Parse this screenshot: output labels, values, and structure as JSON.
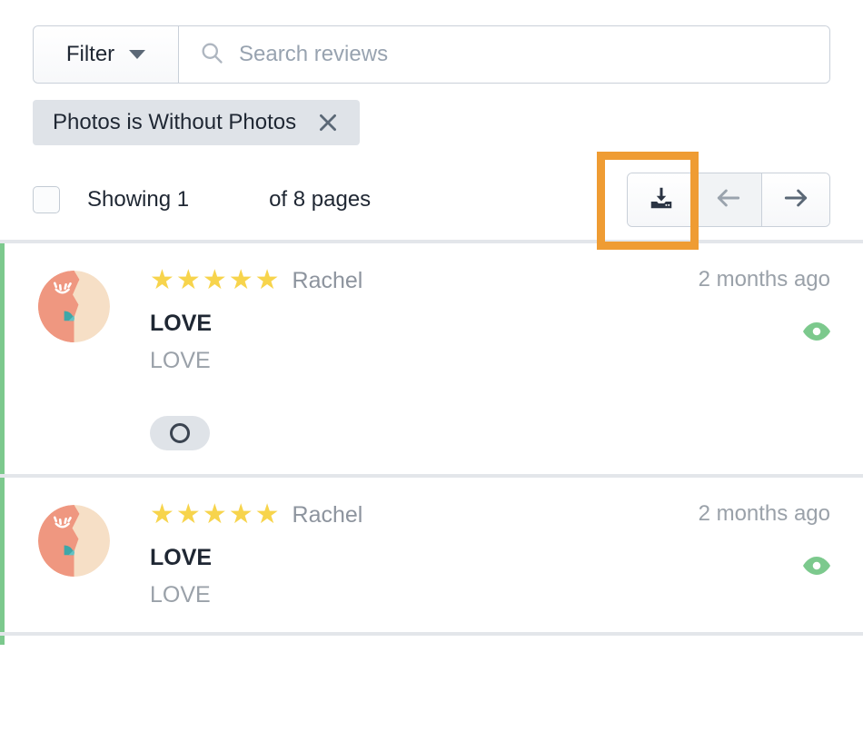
{
  "toolbar": {
    "filter_label": "Filter",
    "filter_caret_icon": "chevron-down-icon",
    "search_icon": "search-icon",
    "search_value": "",
    "search_placeholder": "Search reviews"
  },
  "filter_chip": {
    "label": "Photos is Without Photos",
    "remove_icon": "close-icon"
  },
  "pagination": {
    "select_all_checked": false,
    "showing_text": "Showing 1",
    "of_pages_text": "of 8 pages",
    "current_page": 1,
    "total_pages": 8,
    "download_icon": "download-icon",
    "prev_icon": "arrow-left-icon",
    "next_icon": "arrow-right-icon",
    "prev_enabled": false,
    "next_enabled": true
  },
  "highlight": {
    "target": "download-button",
    "color": "#ef9c33"
  },
  "colors": {
    "accent_green": "#7cc98d",
    "star_yellow": "#f7d44c",
    "chip_bg": "#dfe3e8",
    "eye_green": "#7cc98d",
    "highlight_orange": "#ef9c33"
  },
  "reviews": [
    {
      "avatar_icon": "avatar-face-icon",
      "rating": 5,
      "stars": [
        "★",
        "★",
        "★",
        "★",
        "★"
      ],
      "reviewer": "Rachel",
      "title": "LOVE",
      "body": "LOVE",
      "timestamp": "2 months ago",
      "visibility_icon": "eye-icon",
      "badge_icon": "circle-ring-icon",
      "has_badge": true
    },
    {
      "avatar_icon": "avatar-face-icon",
      "rating": 5,
      "stars": [
        "★",
        "★",
        "★",
        "★",
        "★"
      ],
      "reviewer": "Rachel",
      "title": "LOVE",
      "body": "LOVE",
      "timestamp": "2 months ago",
      "visibility_icon": "eye-icon",
      "badge_icon": "circle-ring-icon",
      "has_badge": false
    }
  ]
}
